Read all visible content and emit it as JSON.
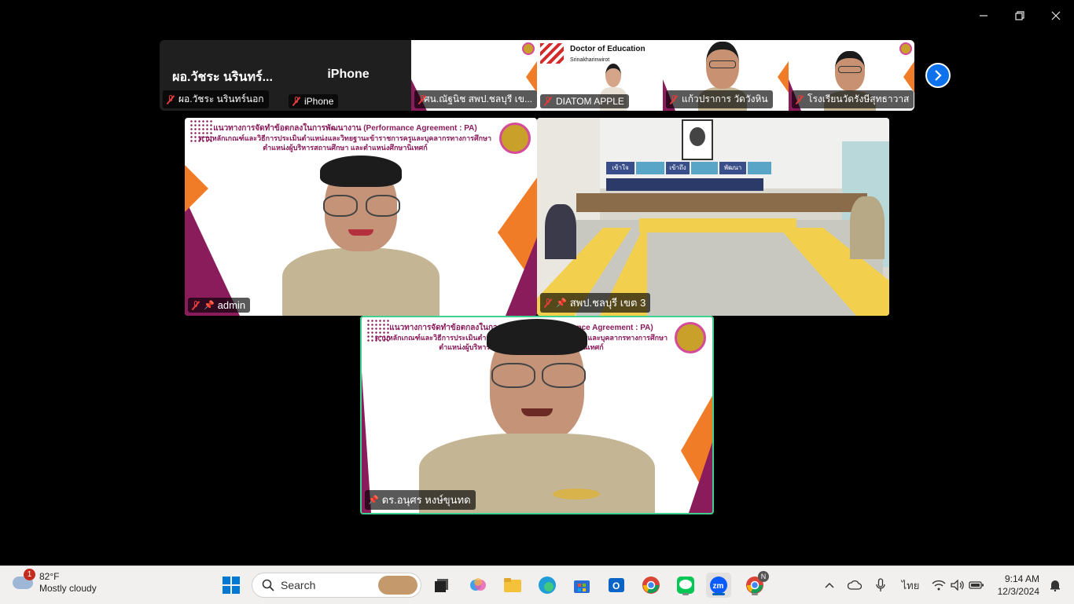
{
  "strip": {
    "tiles": [
      {
        "big_name": "ผอ.วัชระ นรินทร์...",
        "label": "ผอ.วัชระ นรินทร์นอก"
      },
      {
        "big_name": "iPhone",
        "label": "iPhone"
      },
      {
        "label": "ศน.ณัฐนิช สพป.ชลบุรี เข..."
      },
      {
        "label": "DIATOM APPLE",
        "slide_title": "Doctor of Education",
        "slide_sub": "Srinakharinwirot"
      },
      {
        "label": "แก้วปราการ วัดวังหิน"
      },
      {
        "label": "โรงเรียนวัดรังษีสุทธาวาส"
      }
    ]
  },
  "slide": {
    "line1": "แนวทางการจัดทำข้อตกลงในการพัฒนางาน (Performance Agreement : PA)",
    "line2": "ตามหลักเกณฑ์และวิธีการประเมินตำแหน่งและวิทยฐานะข้าราชการครูและบุคลากรทางการศึกษา",
    "line3": "ตำแหน่งผู้บริหารสถานศึกษา และตำแหน่งศึกษานิเทศก์"
  },
  "main": {
    "tile_admin": {
      "label": "admin"
    },
    "tile_room": {
      "label": "สพป.ชลบุรี เขต 3",
      "banners": [
        "เข้าใจ",
        "เข้าถึง",
        "พัฒนา"
      ]
    },
    "tile_speaker": {
      "label": "ดร.อนุศร หงษ์ขุนทด"
    }
  },
  "taskbar": {
    "weather_temp": "82°F",
    "weather_desc": "Mostly cloudy",
    "weather_badge": "1",
    "search_placeholder": "Search",
    "language": "ไทย",
    "time": "9:14 AM",
    "date": "12/3/2024",
    "chrome_badge": "N"
  },
  "colors": {
    "accent_purple": "#8a1c5c",
    "accent_orange": "#f07c28",
    "active_green": "#3fcf8e",
    "zoom_blue": "#0e72ed"
  }
}
